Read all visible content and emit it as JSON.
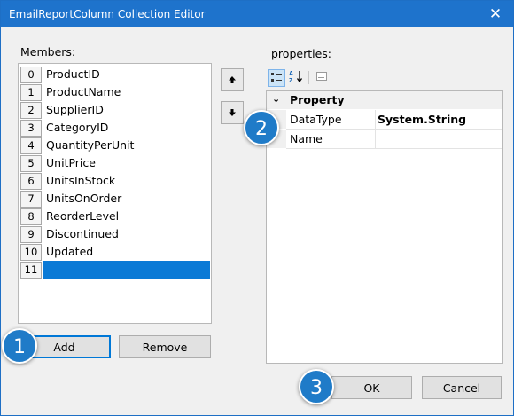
{
  "window": {
    "title": "EmailReportColumn Collection Editor",
    "close_glyph": "✕"
  },
  "members": {
    "label": "Members:",
    "items": [
      {
        "index": "0",
        "name": "ProductID"
      },
      {
        "index": "1",
        "name": "ProductName"
      },
      {
        "index": "2",
        "name": "SupplierID"
      },
      {
        "index": "3",
        "name": "CategoryID"
      },
      {
        "index": "4",
        "name": "QuantityPerUnit"
      },
      {
        "index": "5",
        "name": "UnitPrice"
      },
      {
        "index": "6",
        "name": "UnitsInStock"
      },
      {
        "index": "7",
        "name": "UnitsOnOrder"
      },
      {
        "index": "8",
        "name": "ReorderLevel"
      },
      {
        "index": "9",
        "name": "Discontinued"
      },
      {
        "index": "10",
        "name": "Updated"
      },
      {
        "index": "11",
        "name": ""
      }
    ],
    "selected_index": "11",
    "selection_color": "#0b7ad6"
  },
  "move_buttons": {
    "up_icon": "up-arrow-icon",
    "down_icon": "down-arrow-icon"
  },
  "properties": {
    "label": "properties:",
    "toolbar": {
      "categorized_icon": "categorized-icon",
      "alphabetical_icon": "sort-alphabetical-icon",
      "pages_icon": "property-pages-icon"
    },
    "category": {
      "chevron": "⌄",
      "title": "Property"
    },
    "rows": [
      {
        "name": "DataType",
        "value": "System.String"
      },
      {
        "name": "Name",
        "value": ""
      }
    ]
  },
  "buttons": {
    "add": "Add",
    "remove": "Remove",
    "ok": "OK",
    "cancel": "Cancel"
  },
  "callouts": [
    "1",
    "2",
    "3"
  ],
  "colors": {
    "titlebar": "#1e73cc",
    "callout": "#1f7bc8",
    "accent": "#0078d7"
  }
}
